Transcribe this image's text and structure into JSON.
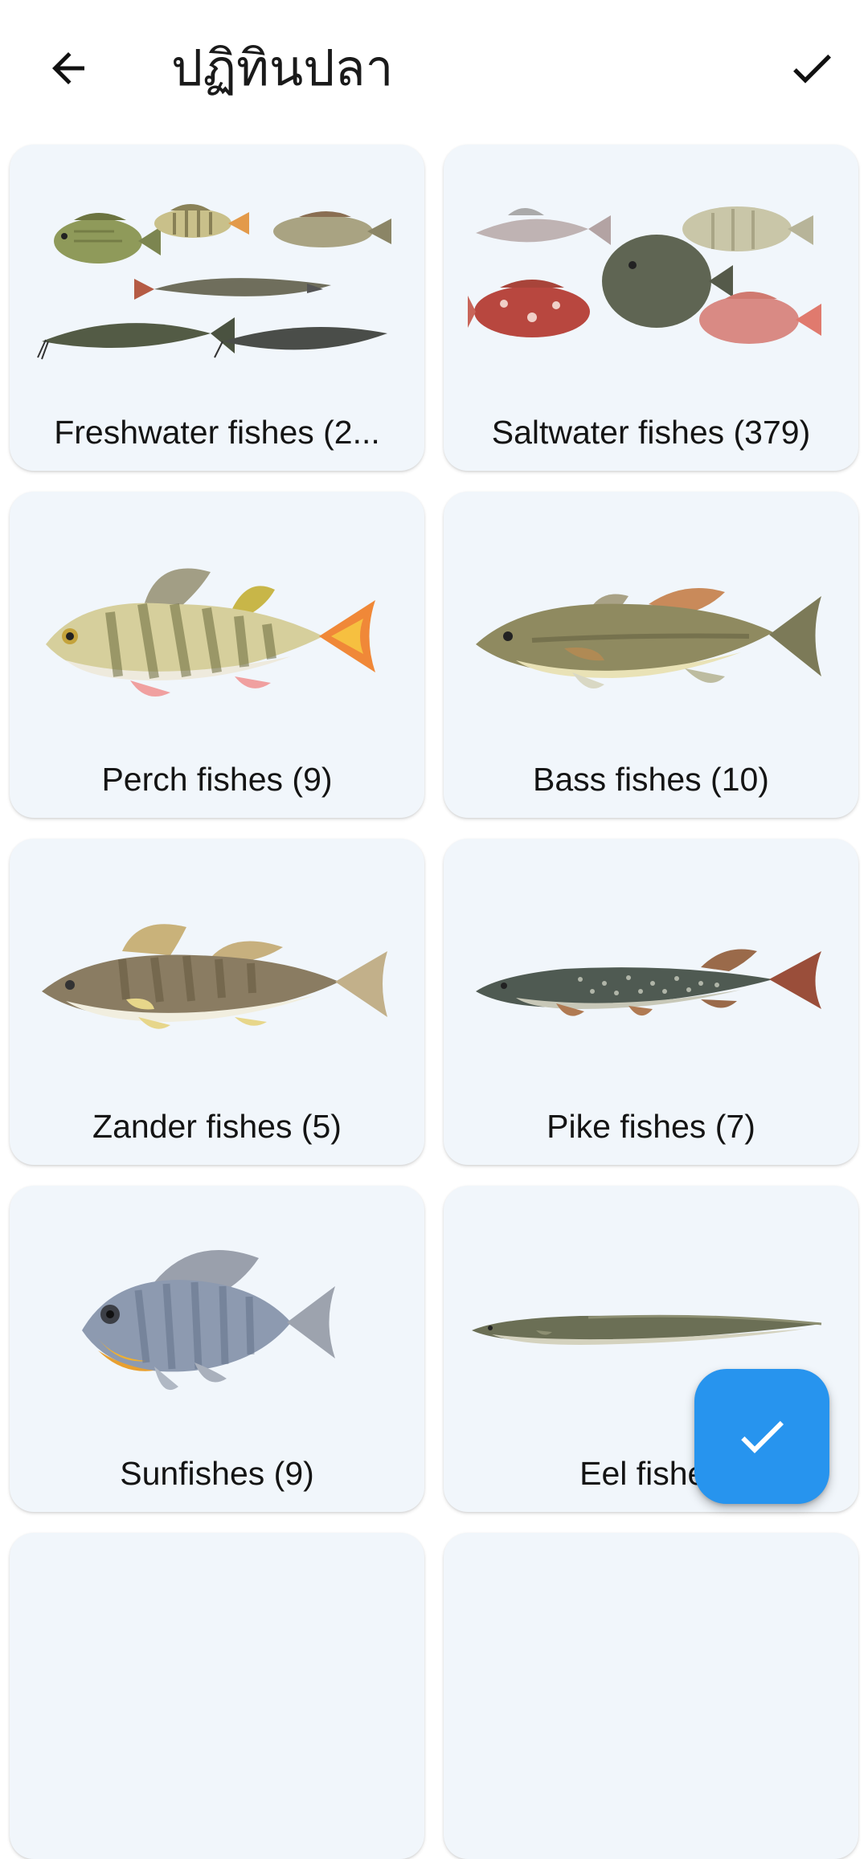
{
  "app_bar": {
    "title": "ปฏิทินปลา",
    "back_icon": "arrow-left-icon",
    "confirm_icon": "check-icon"
  },
  "categories": [
    {
      "label": "Freshwater fishes (2...",
      "icon": "freshwater-fishes-image"
    },
    {
      "label": "Saltwater fishes (379)",
      "icon": "saltwater-fishes-image"
    },
    {
      "label": "Perch fishes (9)",
      "icon": "perch-fish-image"
    },
    {
      "label": "Bass fishes (10)",
      "icon": "bass-fish-image"
    },
    {
      "label": "Zander fishes (5)",
      "icon": "zander-fish-image"
    },
    {
      "label": "Pike fishes (7)",
      "icon": "pike-fish-image"
    },
    {
      "label": "Sunfishes (9)",
      "icon": "sunfish-image"
    },
    {
      "label": "Eel fishes",
      "icon": "eel-fish-image"
    }
  ],
  "fab": {
    "icon": "check-icon",
    "color": "#2794ee"
  },
  "colors": {
    "card_background": "#f1f6fb",
    "accent": "#2794ee"
  }
}
